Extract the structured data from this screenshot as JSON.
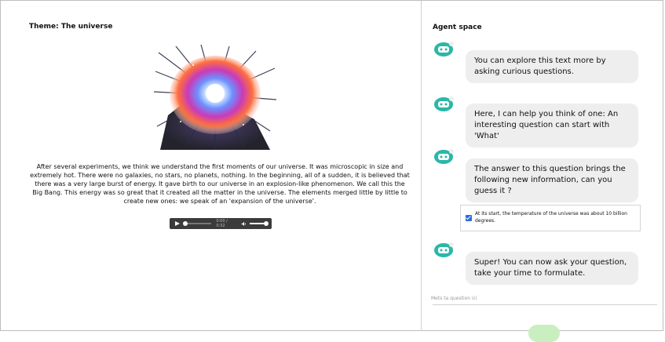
{
  "lesson": {
    "theme_title": "Theme: The universe",
    "image_name": "big-bang-explosion-illustration",
    "paragraph": "After several experiments, we think we understand the first moments of our universe. It was microscopic in size and extremely hot. There were no galaxies, no stars, no planets, nothing. In the beginning, all of a sudden, it is believed that there was a very large burst of energy. It gave birth to our universe in an explosion-like phenomenon. We call this the Big Bang. This energy was so great that it created all the matter in the universe. The elements merged little by little to create new ones: we speak of an 'expansion of the universe'.",
    "audio": {
      "time": "0:00 / 0:32",
      "progress": 0.0,
      "volume": 1.0
    }
  },
  "agent": {
    "title": "Agent space",
    "accent": "#2bb7a8",
    "messages": [
      {
        "text": "You can explore this text more by asking curious questions."
      },
      {
        "text": "Here, I can help you think of one: An interesting question can start with 'What'"
      },
      {
        "text": "The answer to this question brings the following new information, can you guess it ?"
      },
      {
        "text": "Super! You can now ask your question, take your time to formulate."
      }
    ],
    "info": {
      "checked": true,
      "text": "At its start, the temperature of the universe was about 10 billion degrees."
    },
    "input": {
      "placeholder": "Mets ta question ici",
      "value": ""
    },
    "send_color": "#c9efc0"
  }
}
